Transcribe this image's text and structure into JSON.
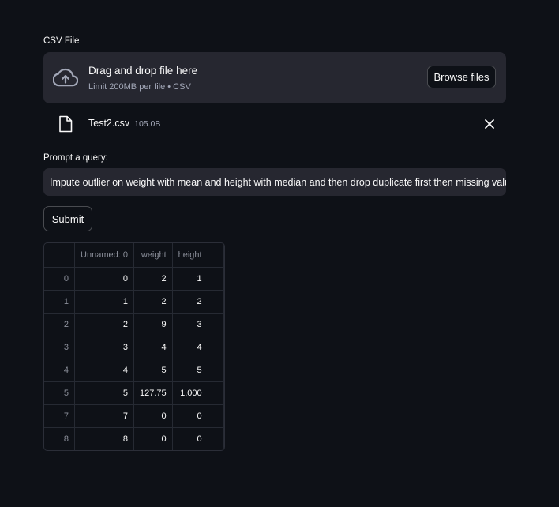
{
  "csv_label": "CSV File",
  "uploader": {
    "title": "Drag and drop file here",
    "subtitle": "Limit 200MB per file • CSV",
    "browse_label": "Browse files"
  },
  "uploaded_file": {
    "name": "Test2.csv",
    "size": "105.0B"
  },
  "prompt_label": "Prompt a query:",
  "query_value": "Impute outlier on weight with mean and height with median and then drop duplicate first then missing value",
  "submit_label": "Submit",
  "table": {
    "columns": [
      "Unnamed: 0",
      "weight",
      "height"
    ],
    "rows": [
      {
        "index": "0",
        "values": [
          "0",
          "2",
          "1"
        ]
      },
      {
        "index": "1",
        "values": [
          "1",
          "2",
          "2"
        ]
      },
      {
        "index": "2",
        "values": [
          "2",
          "9",
          "3"
        ]
      },
      {
        "index": "3",
        "values": [
          "3",
          "4",
          "4"
        ]
      },
      {
        "index": "4",
        "values": [
          "4",
          "5",
          "5"
        ]
      },
      {
        "index": "5",
        "values": [
          "5",
          "127.75",
          "1,000"
        ]
      },
      {
        "index": "7",
        "values": [
          "7",
          "0",
          "0"
        ]
      },
      {
        "index": "8",
        "values": [
          "8",
          "0",
          "0"
        ]
      }
    ]
  },
  "colors": {
    "background": "#0e1117",
    "surface": "#262730",
    "text": "#fafafa",
    "muted": "#a3a8b8"
  }
}
